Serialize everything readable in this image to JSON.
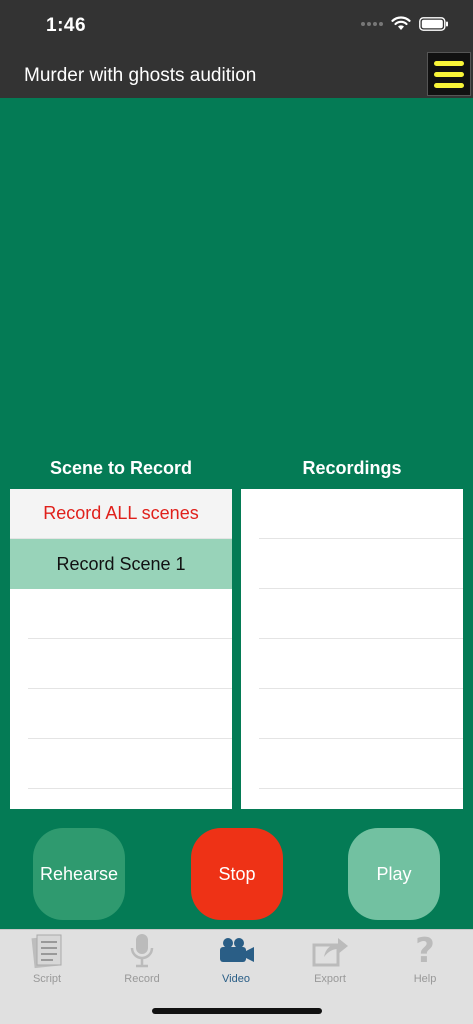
{
  "status_bar": {
    "time": "1:46"
  },
  "nav": {
    "title": "Murder with ghosts audition"
  },
  "scenes_panel": {
    "title": "Scene to Record",
    "items": [
      "Record ALL scenes",
      "Record Scene 1"
    ]
  },
  "recordings_panel": {
    "title": "Recordings"
  },
  "actions": {
    "rehearse": "Rehearse",
    "stop": "Stop",
    "play": "Play"
  },
  "tabs": [
    {
      "label": "Script",
      "icon": "script-icon"
    },
    {
      "label": "Record",
      "icon": "microphone-icon"
    },
    {
      "label": "Video",
      "icon": "video-camera-icon",
      "active": true
    },
    {
      "label": "Export",
      "icon": "export-icon"
    },
    {
      "label": "Help",
      "icon": "help-icon"
    }
  ],
  "colors": {
    "background": "#047b55",
    "header": "#333333",
    "menu_lines": "#f8f438",
    "record_all_text": "#e0201b",
    "selected_row": "#98d3b9",
    "rehearse": "#2f9a6f",
    "stop": "#ee3216",
    "play": "#72c1a1"
  }
}
